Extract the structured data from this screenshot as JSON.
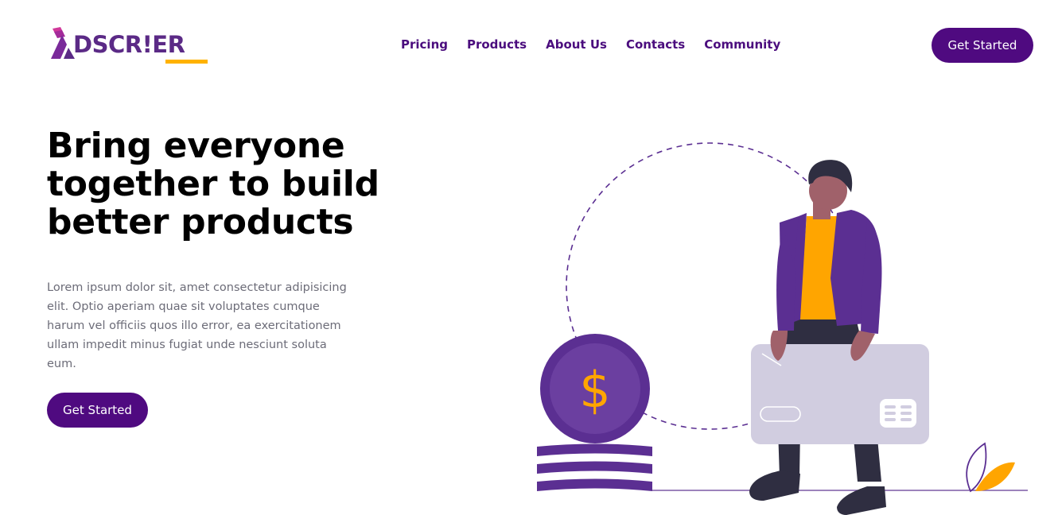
{
  "logo": {
    "text": "ADSCRIER",
    "display": "DSCR!ER"
  },
  "nav": {
    "items": [
      {
        "label": "Pricing"
      },
      {
        "label": "Products"
      },
      {
        "label": "About Us"
      },
      {
        "label": "Contacts"
      },
      {
        "label": "Community"
      }
    ]
  },
  "header": {
    "cta_label": "Get Started"
  },
  "hero": {
    "title": "Bring everyone together to build better products",
    "description": "Lorem ipsum dolor sit, amet consectetur adipisicing elit. Optio aperiam quae sit voluptates cumque harum vel officiis quos illo error, ea exercitationem ullam impedit minus fugiat unde nesciunt soluta eum.",
    "cta_label": "Get Started"
  },
  "illustration": {
    "coin_symbol": "$",
    "colors": {
      "brand": "#4f0a80",
      "purple": "#5b2f92",
      "accent": "#ffa500",
      "card": "#d1cde0",
      "skin": "#a0616a",
      "hair": "#2f2e41"
    }
  }
}
